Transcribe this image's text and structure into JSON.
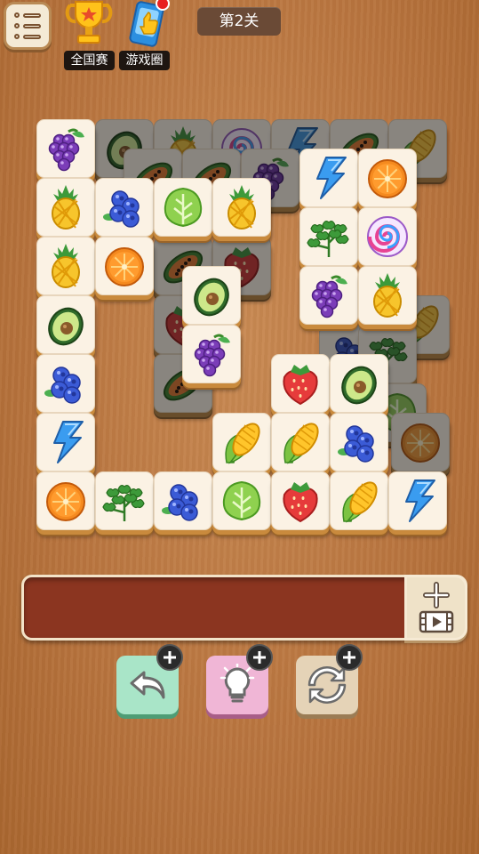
{
  "header": {
    "menu_icon": "menu-list-icon",
    "national_label": "全国赛",
    "national_icon": "trophy-icon",
    "circle_label": "游戏圈",
    "circle_icon": "thumbs-up-card-icon",
    "level_label": "第2关"
  },
  "board": {
    "tiles": [
      {
        "fruit": "grape",
        "dim": false
      },
      {
        "fruit": "avocado",
        "dim": true
      },
      {
        "fruit": "pineapple",
        "dim": true
      },
      {
        "fruit": "candy",
        "dim": true
      },
      {
        "fruit": "lightning",
        "dim": true
      },
      {
        "fruit": "papaya",
        "dim": true
      },
      {
        "fruit": "corn",
        "dim": true
      },
      {
        "fruit": "papaya",
        "dim": true
      },
      {
        "fruit": "papaya",
        "dim": true
      },
      {
        "fruit": "grape",
        "dim": true
      },
      {
        "fruit": "lightning",
        "dim": false
      },
      {
        "fruit": "orange",
        "dim": false
      },
      {
        "fruit": "pineapple",
        "dim": false
      },
      {
        "fruit": "blueberry",
        "dim": false
      },
      {
        "fruit": "lettuce",
        "dim": false
      },
      {
        "fruit": "pineapple",
        "dim": false
      },
      {
        "fruit": "parsley",
        "dim": false
      },
      {
        "fruit": "candy",
        "dim": false
      },
      {
        "fruit": "pineapple",
        "dim": false
      },
      {
        "fruit": "orange",
        "dim": false
      },
      {
        "fruit": "papaya",
        "dim": true
      },
      {
        "fruit": "strawberry",
        "dim": true
      },
      {
        "fruit": "grape",
        "dim": false
      },
      {
        "fruit": "pineapple",
        "dim": false
      },
      {
        "fruit": "blueberry",
        "dim": true
      },
      {
        "fruit": "avocado",
        "dim": false
      },
      {
        "fruit": "strawberry",
        "dim": true
      },
      {
        "fruit": "avocado",
        "dim": false
      },
      {
        "fruit": "parsley",
        "dim": true
      },
      {
        "fruit": "corn",
        "dim": true
      },
      {
        "fruit": "grape",
        "dim": false
      },
      {
        "fruit": "blueberry",
        "dim": false
      },
      {
        "fruit": "papaya",
        "dim": true
      },
      {
        "fruit": "strawberry",
        "dim": false
      },
      {
        "fruit": "avocado",
        "dim": false
      },
      {
        "fruit": "lettuce",
        "dim": true
      },
      {
        "fruit": "lightning",
        "dim": false
      },
      {
        "fruit": "corn",
        "dim": false
      },
      {
        "fruit": "corn",
        "dim": false
      },
      {
        "fruit": "blueberry",
        "dim": false
      },
      {
        "fruit": "orange",
        "dim": true
      },
      {
        "fruit": "orange",
        "dim": false
      },
      {
        "fruit": "parsley",
        "dim": false
      },
      {
        "fruit": "blueberry",
        "dim": false
      },
      {
        "fruit": "lettuce",
        "dim": false
      },
      {
        "fruit": "strawberry",
        "dim": false
      },
      {
        "fruit": "corn",
        "dim": false
      },
      {
        "fruit": "lightning",
        "dim": false
      }
    ]
  },
  "tray": {
    "add_icon": "plus-icon",
    "video_icon": "video-ad-icon"
  },
  "tools": {
    "undo_icon": "undo-arrow-icon",
    "hint_icon": "lightbulb-icon",
    "shuffle_icon": "shuffle-arrows-icon",
    "badge_icon": "plus-icon"
  },
  "colors": {
    "tray": "#8b3520",
    "undo": "#a9e5c8",
    "hint": "#f0b6d6",
    "shuffle": "#e5d3b7"
  }
}
